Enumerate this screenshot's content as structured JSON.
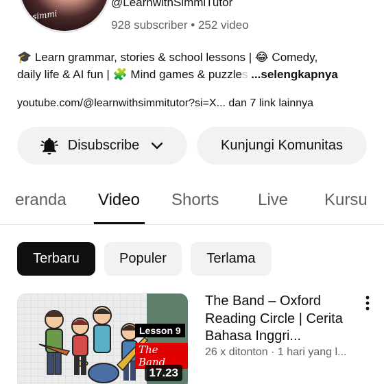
{
  "channel": {
    "handle": "@LearnwithSimmiTutor",
    "subscribers": "928 subscriber",
    "separator": "•",
    "videos": "252 video",
    "avatar_script": "simmi",
    "description_line1": "🎓 Learn grammar, stories & school lessons | 😂 Comedy,",
    "description_line2": "daily life & AI fun | 🧩 Mind games & puzzle",
    "description_fade": "s",
    "description_more": "...selengkapnya",
    "link": "youtube.com/@learnwithsimmitutor?si=X...",
    "more_links": "dan 7 link lainnya"
  },
  "buttons": {
    "subscribe_label": "Disubscribe",
    "community_label": "Kunjungi Komunitas"
  },
  "tabs": [
    {
      "label": "eranda",
      "active": false
    },
    {
      "label": "Video",
      "active": true
    },
    {
      "label": "Shorts",
      "active": false
    },
    {
      "label": "Live",
      "active": false
    },
    {
      "label": "Kursu",
      "active": false
    }
  ],
  "chips": [
    {
      "label": "Terbaru",
      "active": true
    },
    {
      "label": "Populer",
      "active": false
    },
    {
      "label": "Terlama",
      "active": false
    }
  ],
  "video": {
    "title": "The Band – Oxford Reading Circle | Cerita Bahasa Inggri...",
    "meta": "26 x ditonton · 1 hari yang l...",
    "duration": "17.23",
    "thumb_lesson": "Lesson 9",
    "thumb_band": "The Band"
  },
  "icons": {
    "bell": "bell-filled-icon",
    "chevron": "chevron-down-icon",
    "kebab": "more-vert-icon"
  }
}
